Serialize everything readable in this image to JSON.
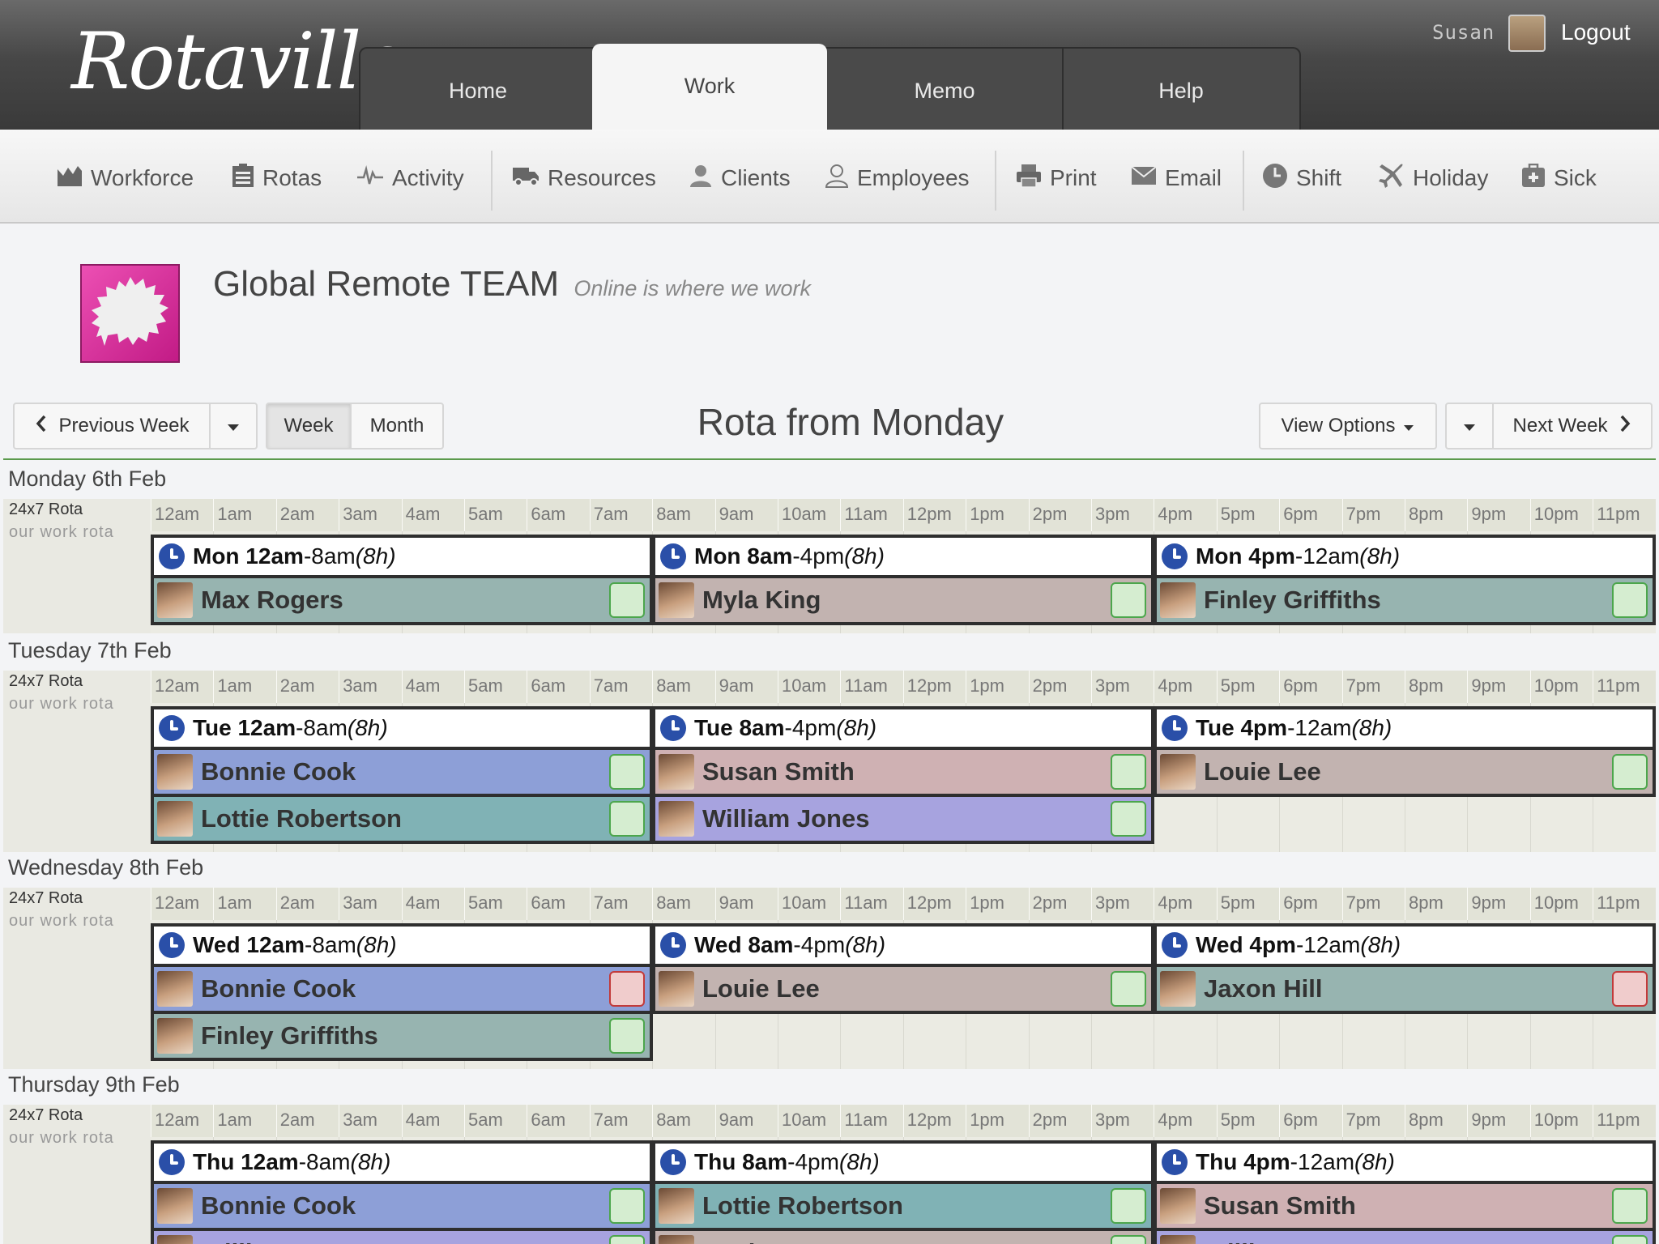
{
  "app": {
    "logo_text": "Rotaville",
    "tabs": [
      {
        "label": "Home",
        "active": false
      },
      {
        "label": "Work",
        "active": true
      },
      {
        "label": "Memo",
        "active": false
      },
      {
        "label": "Help",
        "active": false
      }
    ],
    "user": {
      "name": "Susan",
      "logout_label": "Logout"
    }
  },
  "toolbar": {
    "items": [
      {
        "label": "Workforce",
        "icon": "workforce-chart-icon"
      },
      {
        "label": "Rotas",
        "icon": "rotas-list-icon"
      },
      {
        "label": "Activity",
        "icon": "activity-pulse-icon"
      },
      {
        "label": "Resources",
        "icon": "resources-truck-icon"
      },
      {
        "label": "Clients",
        "icon": "clients-person-icon"
      },
      {
        "label": "Employees",
        "icon": "employees-person-icon"
      },
      {
        "label": "Print",
        "icon": "print-icon"
      },
      {
        "label": "Email",
        "icon": "email-envelope-icon"
      },
      {
        "label": "Shift",
        "icon": "shift-clock-icon"
      },
      {
        "label": "Holiday",
        "icon": "holiday-plane-icon"
      },
      {
        "label": "Sick",
        "icon": "sick-medical-icon"
      }
    ]
  },
  "team": {
    "name": "Global Remote TEAM",
    "tagline": "Online is where we work",
    "logo_icon": "speech-bubble-icon",
    "logo_color": "#e03fa8"
  },
  "nav": {
    "previous_label": "Previous Week",
    "week_label": "Week",
    "month_label": "Month",
    "title": "Rota from Monday",
    "view_options_label": "View Options",
    "next_label": "Next Week",
    "selected_view": "Week"
  },
  "hours": [
    "12am",
    "1am",
    "2am",
    "3am",
    "4am",
    "5am",
    "6am",
    "7am",
    "8am",
    "9am",
    "10am",
    "11am",
    "12pm",
    "1pm",
    "2pm",
    "3pm",
    "4pm",
    "5pm",
    "6pm",
    "7pm",
    "8pm",
    "9pm",
    "10pm",
    "11pm"
  ],
  "rota": {
    "name": "24x7 Rota",
    "description": "our work rota"
  },
  "colors": {
    "accent_line": "#5b9a4c",
    "clock": "#2a4fa8",
    "check_ok": "#4ca64c",
    "check_bad": "#c23a3a"
  },
  "days": [
    {
      "label": "Monday 6th Feb",
      "shifts": [
        {
          "day": "Mon",
          "start": "12am",
          "end": "8am",
          "hours": "(8h)",
          "employees": [
            {
              "name": "Max Rogers",
              "color": "teal",
              "status": "ok"
            }
          ]
        },
        {
          "day": "Mon",
          "start": "8am",
          "end": "4pm",
          "hours": "(8h)",
          "employees": [
            {
              "name": "Myla King",
              "color": "mauve",
              "status": "ok"
            }
          ]
        },
        {
          "day": "Mon",
          "start": "4pm",
          "end": "12am",
          "hours": "(8h)",
          "employees": [
            {
              "name": "Finley Griffiths",
              "color": "teal",
              "status": "ok"
            }
          ]
        }
      ]
    },
    {
      "label": "Tuesday 7th Feb",
      "shifts": [
        {
          "day": "Tue",
          "start": "12am",
          "end": "8am",
          "hours": "(8h)",
          "employees": [
            {
              "name": "Bonnie Cook",
              "color": "blue",
              "status": "ok"
            },
            {
              "name": "Lottie Robertson",
              "color": "teal2",
              "status": "ok"
            }
          ]
        },
        {
          "day": "Tue",
          "start": "8am",
          "end": "4pm",
          "hours": "(8h)",
          "employees": [
            {
              "name": "Susan Smith",
              "color": "pink",
              "status": "ok"
            },
            {
              "name": "William Jones",
              "color": "purple",
              "status": "ok"
            }
          ]
        },
        {
          "day": "Tue",
          "start": "4pm",
          "end": "12am",
          "hours": "(8h)",
          "employees": [
            {
              "name": "Louie Lee",
              "color": "mauve",
              "status": "ok"
            }
          ]
        }
      ]
    },
    {
      "label": "Wednesday 8th Feb",
      "shifts": [
        {
          "day": "Wed",
          "start": "12am",
          "end": "8am",
          "hours": "(8h)",
          "employees": [
            {
              "name": "Bonnie Cook",
              "color": "blue",
              "status": "bad"
            },
            {
              "name": "Finley Griffiths",
              "color": "teal",
              "status": "ok"
            }
          ]
        },
        {
          "day": "Wed",
          "start": "8am",
          "end": "4pm",
          "hours": "(8h)",
          "employees": [
            {
              "name": "Louie Lee",
              "color": "mauve",
              "status": "ok"
            }
          ]
        },
        {
          "day": "Wed",
          "start": "4pm",
          "end": "12am",
          "hours": "(8h)",
          "employees": [
            {
              "name": "Jaxon Hill",
              "color": "teal",
              "status": "bad"
            }
          ]
        }
      ]
    },
    {
      "label": "Thursday 9th Feb",
      "shifts": [
        {
          "day": "Thu",
          "start": "12am",
          "end": "8am",
          "hours": "(8h)",
          "employees": [
            {
              "name": "Bonnie Cook",
              "color": "blue",
              "status": "ok"
            },
            {
              "name": "William Jones",
              "color": "purple",
              "status": "ok"
            }
          ]
        },
        {
          "day": "Thu",
          "start": "8am",
          "end": "4pm",
          "hours": "(8h)",
          "employees": [
            {
              "name": "Lottie Robertson",
              "color": "teal2",
              "status": "ok"
            },
            {
              "name": "Louie Lee",
              "color": "mauve",
              "status": "ok"
            }
          ]
        },
        {
          "day": "Thu",
          "start": "4pm",
          "end": "12am",
          "hours": "(8h)",
          "employees": [
            {
              "name": "Susan Smith",
              "color": "pink",
              "status": "ok"
            },
            {
              "name": "William Jones",
              "color": "purple",
              "status": "ok"
            }
          ]
        }
      ]
    }
  ]
}
